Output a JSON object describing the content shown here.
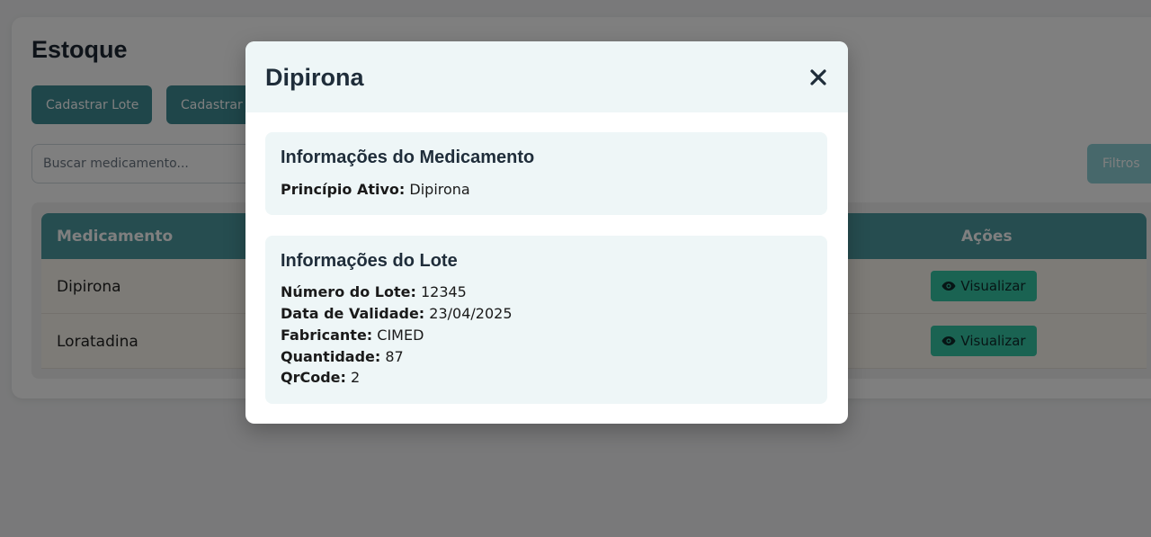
{
  "page": {
    "title": "Estoque",
    "buttons": {
      "cadastrar_lote": "Cadastrar Lote",
      "cadastrar_medicamento": "Cadastrar Medicamento",
      "filtros": "Filtros"
    },
    "search": {
      "placeholder": "Buscar medicamento...",
      "value": ""
    },
    "table": {
      "headers": {
        "medicamento": "Medicamento",
        "acoes": "Ações"
      },
      "rows": [
        {
          "name": "Dipirona",
          "action": "Visualizar"
        },
        {
          "name": "Loratadina",
          "action": "Visualizar"
        }
      ]
    }
  },
  "modal": {
    "title": "Dipirona",
    "close_icon": "close-icon",
    "medicamento": {
      "section_title": "Informações do Medicamento",
      "principio_ativo_label": "Princípio Ativo:",
      "principio_ativo_value": "Dipirona"
    },
    "lote": {
      "section_title": "Informações do Lote",
      "numero_label": "Número do Lote:",
      "numero_value": "12345",
      "validade_label": "Data de Validade:",
      "validade_value": "23/04/2025",
      "fabricante_label": "Fabricante:",
      "fabricante_value": "CIMED",
      "quantidade_label": "Quantidade:",
      "quantidade_value": "87",
      "qrcode_label": "QrCode:",
      "qrcode_value": "2"
    }
  },
  "colors": {
    "primary": "#3f8c95",
    "table_header": "#4d9aa1",
    "view_button": "#34c6a4",
    "modal_section": "#eef6f7"
  }
}
